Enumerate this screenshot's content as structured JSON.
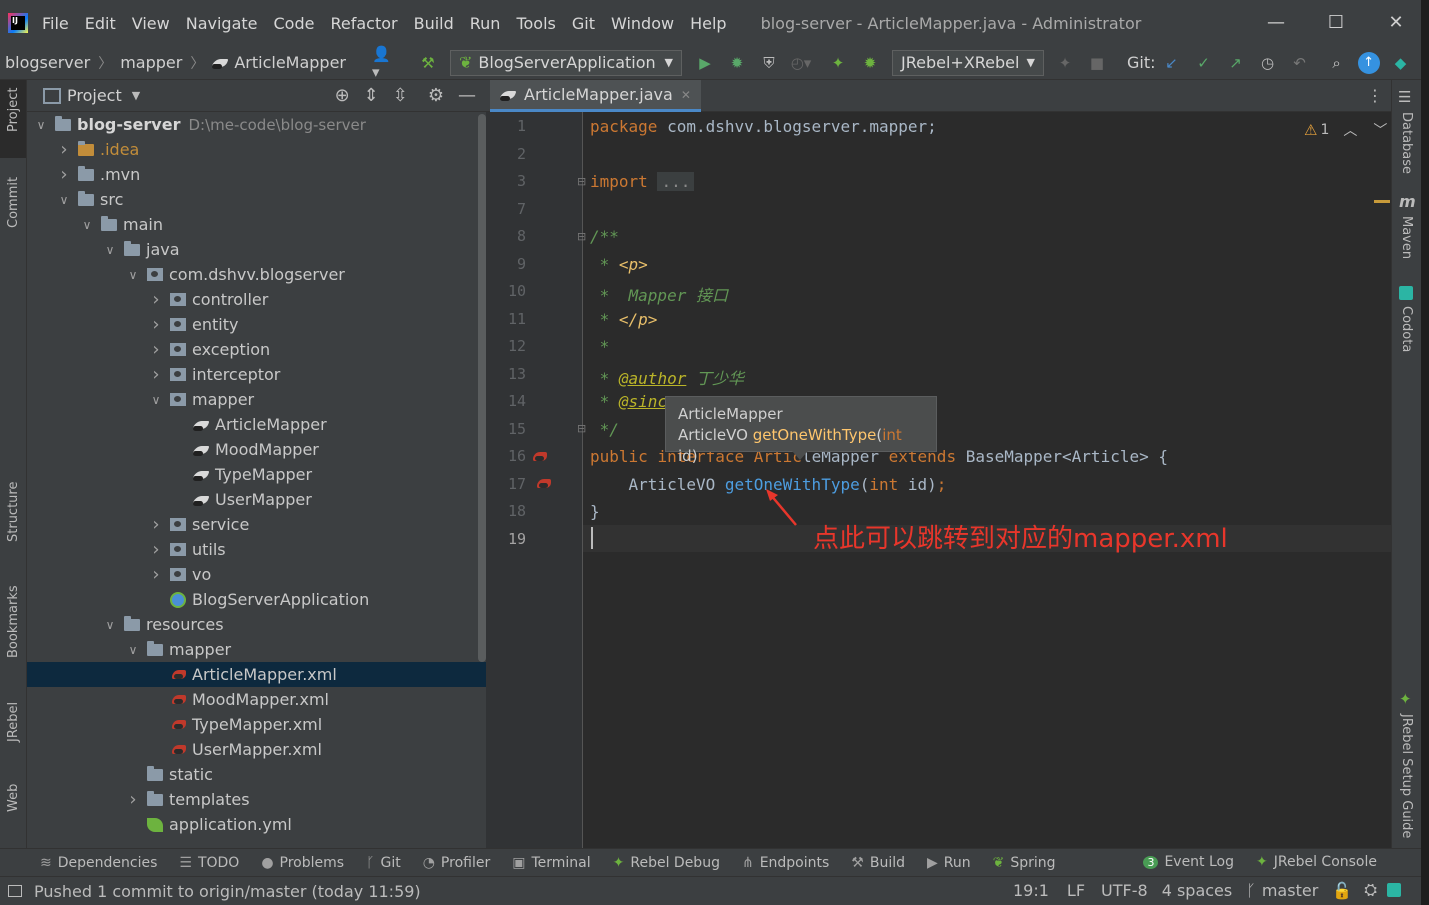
{
  "window": {
    "title": "blog-server - ArticleMapper.java - Administrator",
    "menu": [
      "File",
      "Edit",
      "View",
      "Navigate",
      "Code",
      "Refactor",
      "Build",
      "Run",
      "Tools",
      "Git",
      "Window",
      "Help"
    ]
  },
  "breadcrumb": [
    "blogserver",
    "mapper",
    "ArticleMapper"
  ],
  "toolbar": {
    "run_config": "BlogServerApplication",
    "jrebel_config": "JRebel+XRebel",
    "git_label": "Git:"
  },
  "left_stripe": [
    "Project",
    "Commit",
    "Structure",
    "Bookmarks",
    "JRebel",
    "Web"
  ],
  "right_stripe": [
    "Database",
    "Maven",
    "Codota",
    "JRebel Setup Guide"
  ],
  "project_panel": {
    "title": "Project",
    "root_name": "blog-server",
    "root_path": "D:\\me-code\\blog-server",
    "items": [
      {
        "label": ".idea",
        "depth": 1,
        "type": "folder",
        "arrow": ">",
        "color": "#c28d3a"
      },
      {
        "label": ".mvn",
        "depth": 1,
        "type": "folder",
        "arrow": ">"
      },
      {
        "label": "src",
        "depth": 1,
        "type": "folder",
        "arrow": "v"
      },
      {
        "label": "main",
        "depth": 2,
        "type": "folder",
        "arrow": "v"
      },
      {
        "label": "java",
        "depth": 3,
        "type": "folder",
        "arrow": "v"
      },
      {
        "label": "com.dshvv.blogserver",
        "depth": 4,
        "type": "package",
        "arrow": "v"
      },
      {
        "label": "controller",
        "depth": 5,
        "type": "package",
        "arrow": ">"
      },
      {
        "label": "entity",
        "depth": 5,
        "type": "package",
        "arrow": ">"
      },
      {
        "label": "exception",
        "depth": 5,
        "type": "package",
        "arrow": ">"
      },
      {
        "label": "interceptor",
        "depth": 5,
        "type": "package",
        "arrow": ">"
      },
      {
        "label": "mapper",
        "depth": 5,
        "type": "package",
        "arrow": "v"
      },
      {
        "label": "ArticleMapper",
        "depth": 6,
        "type": "mapper"
      },
      {
        "label": "MoodMapper",
        "depth": 6,
        "type": "mapper"
      },
      {
        "label": "TypeMapper",
        "depth": 6,
        "type": "mapper"
      },
      {
        "label": "UserMapper",
        "depth": 6,
        "type": "mapper"
      },
      {
        "label": "service",
        "depth": 5,
        "type": "package",
        "arrow": ">"
      },
      {
        "label": "utils",
        "depth": 5,
        "type": "package",
        "arrow": ">"
      },
      {
        "label": "vo",
        "depth": 5,
        "type": "package",
        "arrow": ">"
      },
      {
        "label": "BlogServerApplication",
        "depth": 5,
        "type": "app"
      },
      {
        "label": "resources",
        "depth": 3,
        "type": "folder",
        "arrow": "v"
      },
      {
        "label": "mapper",
        "depth": 4,
        "type": "folder",
        "arrow": "v"
      },
      {
        "label": "ArticleMapper.xml",
        "depth": 5,
        "type": "xml",
        "selected": true
      },
      {
        "label": "MoodMapper.xml",
        "depth": 5,
        "type": "xml"
      },
      {
        "label": "TypeMapper.xml",
        "depth": 5,
        "type": "xml"
      },
      {
        "label": "UserMapper.xml",
        "depth": 5,
        "type": "xml"
      },
      {
        "label": "static",
        "depth": 4,
        "type": "folder"
      },
      {
        "label": "templates",
        "depth": 4,
        "type": "folder",
        "arrow": ">"
      },
      {
        "label": "application.yml",
        "depth": 4,
        "type": "yml"
      }
    ]
  },
  "editor": {
    "tab_label": "ArticleMapper.java",
    "inspection_count": "1",
    "line_numbers": [
      "1",
      "2",
      "3",
      "7",
      "8",
      "9",
      "10",
      "11",
      "12",
      "13",
      "14",
      "15",
      "16",
      "17",
      "18",
      "19"
    ],
    "code": {
      "l1_kw": "package ",
      "l1_rest": "com.dshvv.blogserver.mapper;",
      "l3_kw": "import ",
      "l3_fold": "...",
      "l8": "/**",
      "l9_star": " * ",
      "l9_tag": "<p>",
      "l10": " *  Mapper 接口",
      "l11_star": " * ",
      "l11_tag": "</p>",
      "l12": " *",
      "l13_star": " * ",
      "l13_ann": "@author",
      "l13_rest": " 丁少华",
      "l14_star": " * ",
      "l14_ann": "@sinc",
      "l15": " */",
      "l16_kw": "public ",
      "l16_hidden": "interface Artic",
      "l16_hidden2": "leMapper ",
      "l16_kw2": "extends ",
      "l16_rest": "BaseMapper<Article> {",
      "l17_type": "    ArticleVO ",
      "l17_fn": "getOneWithType",
      "l17_p1": "(",
      "l17_kw": "int",
      "l17_p2": " id)",
      "l17_semi": ";",
      "l18": "}"
    }
  },
  "tooltip": {
    "line1": "ArticleMapper",
    "line2_type": "ArticleVO ",
    "line2_fn": "getOneWithType",
    "line2_p1": "(",
    "line2_kw": "int",
    "line2_p2": " id)"
  },
  "annotation": {
    "text": "点此可以跳转到对应的mapper.xml",
    "color": "#e8362b"
  },
  "tool_windows": [
    {
      "icon": "≋",
      "label": "Dependencies"
    },
    {
      "icon": "☰",
      "label": "TODO"
    },
    {
      "icon": "●",
      "label": "Problems"
    },
    {
      "icon": "ᚴ",
      "label": "Git"
    },
    {
      "icon": "◔",
      "label": "Profiler"
    },
    {
      "icon": "▣",
      "label": "Terminal"
    },
    {
      "icon": "✦",
      "label": "Rebel Debug"
    },
    {
      "icon": "⋔",
      "label": "Endpoints"
    },
    {
      "icon": "⚒",
      "label": "Build"
    },
    {
      "icon": "▶",
      "label": "Run"
    },
    {
      "icon": "❦",
      "label": "Spring"
    }
  ],
  "tool_windows_right": [
    {
      "icon": "3",
      "label": "Event Log"
    },
    {
      "icon": "✦",
      "label": "JRebel Console"
    }
  ],
  "status": {
    "message": "Pushed 1 commit to origin/master (today 11:59)",
    "position": "19:1",
    "line_sep": "LF",
    "encoding": "UTF-8",
    "indent": "4 spaces",
    "branch": "master"
  }
}
